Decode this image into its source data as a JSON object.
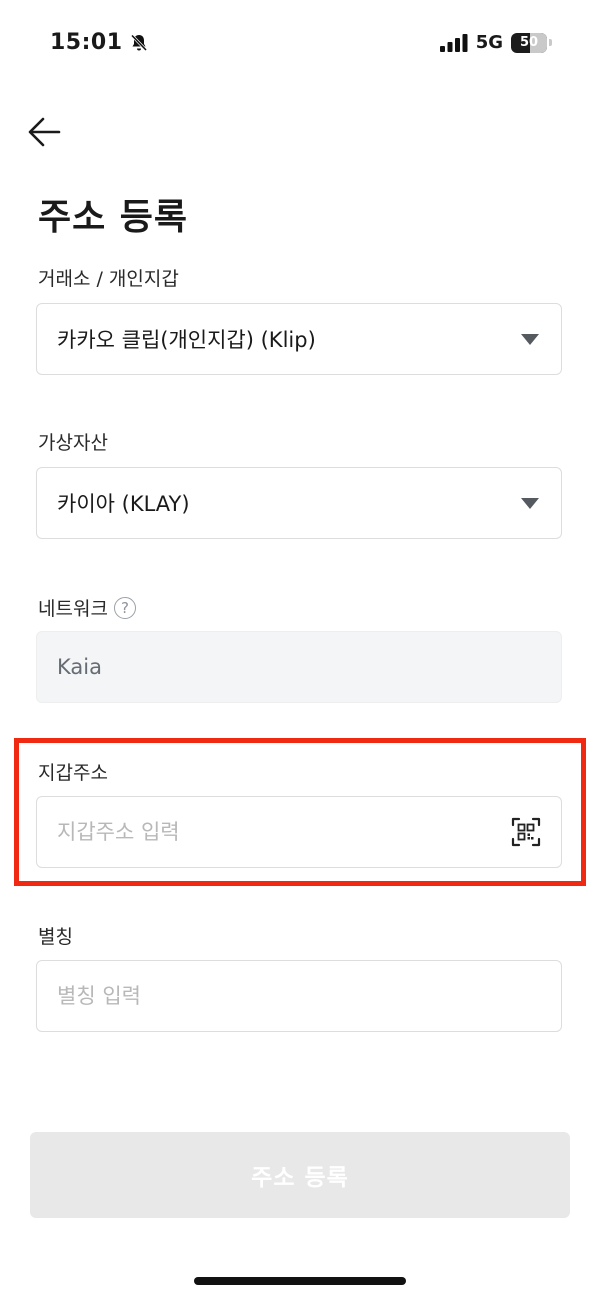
{
  "status_bar": {
    "time": "15:01",
    "network": "5G",
    "battery": "50"
  },
  "page": {
    "title": "주소 등록"
  },
  "form": {
    "exchange": {
      "label": "거래소 / 개인지갑",
      "value": "카카오 클립(개인지갑) (Klip)"
    },
    "asset": {
      "label": "가상자산",
      "value": "카이아 (KLAY)"
    },
    "network": {
      "label": "네트워크",
      "help_symbol": "?",
      "value": "Kaia"
    },
    "wallet_address": {
      "label": "지갑주소",
      "value": "",
      "placeholder": "지갑주소 입력"
    },
    "nickname": {
      "label": "별칭",
      "value": "",
      "placeholder": "별칭 입력"
    }
  },
  "submit": {
    "label": "주소 등록"
  },
  "colors": {
    "highlight": "#f02a12",
    "disabled_button": "#e8e8e8",
    "disabled_field": "#f4f5f6"
  },
  "icons": {
    "back": "arrow-left-icon",
    "dropdown": "triangle-down-icon",
    "help": "question-circle-icon",
    "qr": "qr-scan-icon",
    "silent": "bell-slash-icon",
    "signal": "signal-bars-icon"
  }
}
